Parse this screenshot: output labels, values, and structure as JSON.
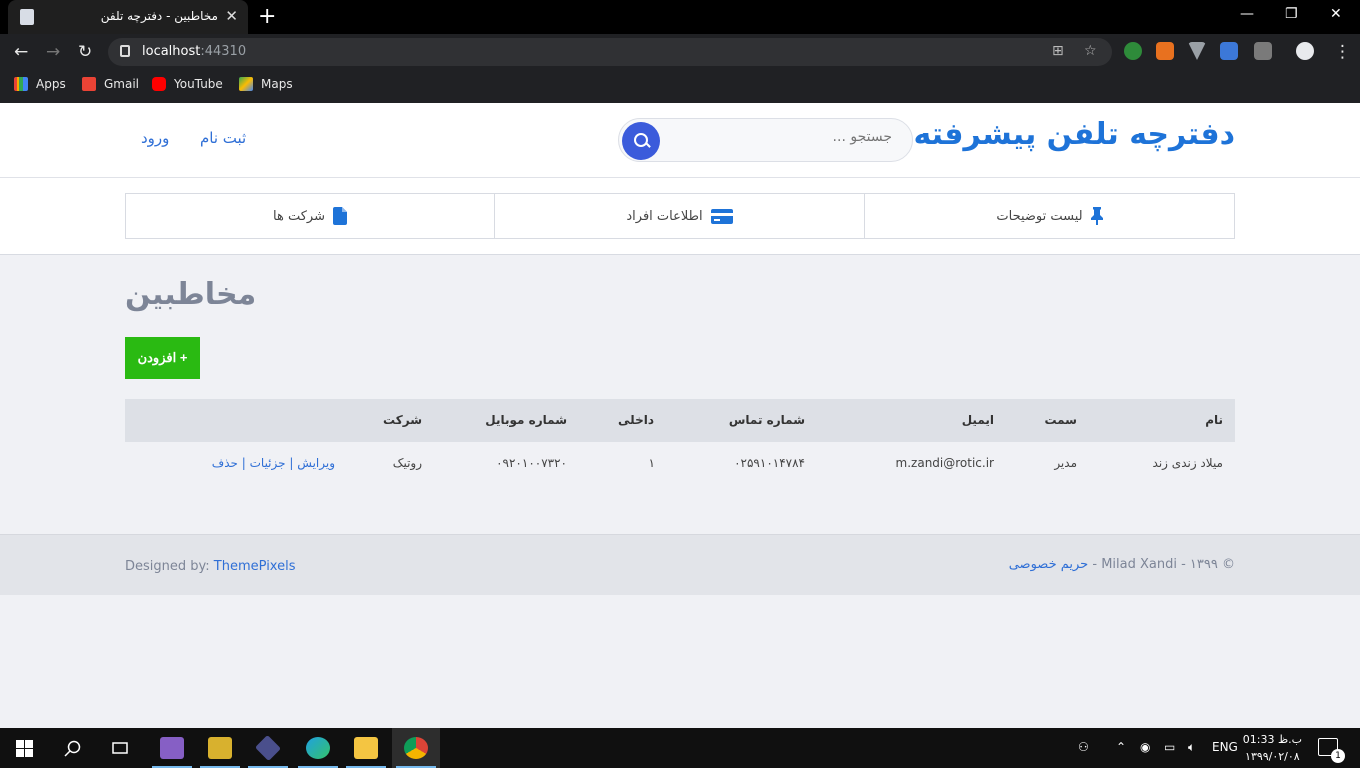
{
  "browser": {
    "tab_title": "مخاطبین - دفترچه تلفن",
    "new_tab": "+",
    "url_host": "localhost",
    "url_port": ":44310",
    "bookmarks": [
      "Apps",
      "Gmail",
      "YouTube",
      "Maps"
    ]
  },
  "site": {
    "brand": "دفترچه تلفن پیشرفته",
    "search_placeholder": "جستجو ...",
    "register": "ثبت نام",
    "login": "ورود",
    "nav": [
      {
        "label": "لیست توضیحات",
        "icon": "pin-icon"
      },
      {
        "label": "اطلاعات افراد",
        "icon": "card-icon"
      },
      {
        "label": "شرکت ها",
        "icon": "document-icon"
      }
    ]
  },
  "main": {
    "title": "مخاطبین",
    "add_button": "+ افزودن",
    "table": {
      "headers": {
        "name": "نام",
        "position": "سمت",
        "email": "ایمیل",
        "phone": "شماره تماس",
        "ext": "داخلی",
        "mobile": "شماره موبایل",
        "company": "شرکت"
      },
      "rows": [
        {
          "name": "میلاد زندی زند",
          "position": "مدیر",
          "email": "m.zandi@rotic.ir",
          "phone": "۰۲۵۹۱۰۱۴۷۸۴",
          "ext": "۱",
          "mobile": "۰۹۲۰۱۰۰۷۳۲۰",
          "company": "روتیک",
          "edit": "ویرایش",
          "details": "جزئیات",
          "delete": "حذف",
          "separator": "|"
        }
      ]
    }
  },
  "footer": {
    "designed_by_label": "Designed by:",
    "designed_by_link": "ThemePixels",
    "copyright": "© ۱۳۹۹ - Milad Xandi - ",
    "privacy": "حریم خصوصی"
  },
  "taskbar": {
    "lang": "ENG",
    "time": "ب.ظ 01:33",
    "date": "۱۳۹۹/۰۲/۰۸",
    "notif_count": "1"
  },
  "colors": {
    "brand": "#1e73d8",
    "add_button": "#2aba12",
    "search_button": "#3b5bdb",
    "link": "#2f6fd6"
  }
}
